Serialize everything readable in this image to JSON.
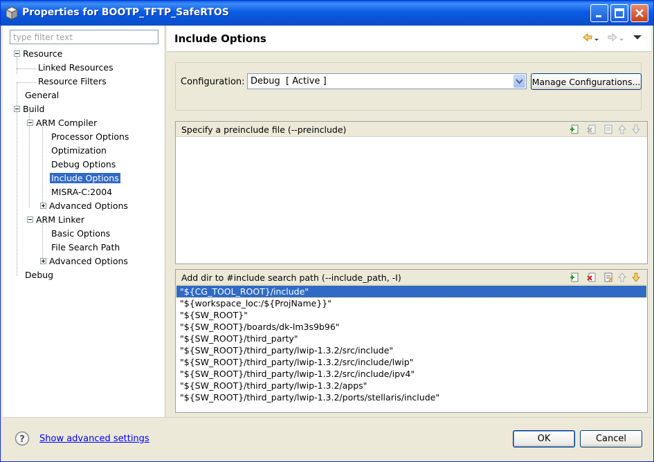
{
  "window": {
    "title": "Properties for BOOTP_TFTP_SafeRTOS"
  },
  "filter": {
    "placeholder": "type filter text"
  },
  "tree": [
    {
      "label": "Resource",
      "expander": "minus"
    },
    {
      "label": "Linked Resources"
    },
    {
      "label": "Resource Filters"
    },
    {
      "label": "General"
    },
    {
      "label": "Build",
      "expander": "minus"
    },
    {
      "label": "ARM Compiler",
      "expander": "minus"
    },
    {
      "label": "Processor Options"
    },
    {
      "label": "Optimization"
    },
    {
      "label": "Debug Options"
    },
    {
      "label": "Include Options",
      "selected": true
    },
    {
      "label": "MISRA-C:2004"
    },
    {
      "label": "Advanced Options",
      "expander": "plus"
    },
    {
      "label": "ARM Linker",
      "expander": "minus"
    },
    {
      "label": "Basic Options"
    },
    {
      "label": "File Search Path"
    },
    {
      "label": "Advanced Options",
      "expander": "plus"
    },
    {
      "label": "Debug"
    }
  ],
  "page": {
    "title": "Include Options"
  },
  "config": {
    "label": "Configuration:",
    "value": "Debug  [ Active ]",
    "manage_label": "Manage Configurations..."
  },
  "preinclude": {
    "title": "Specify a preinclude file (--preinclude)",
    "items": []
  },
  "include_path": {
    "title": "Add dir to #include search path (--include_path, -I)",
    "items": [
      "\"${CG_TOOL_ROOT}/include\"",
      "\"${workspace_loc:/${ProjName}}\"",
      "\"${SW_ROOT}\"",
      "\"${SW_ROOT}/boards/dk-lm3s9b96\"",
      "\"${SW_ROOT}/third_party\"",
      "\"${SW_ROOT}/third_party/lwip-1.3.2/src/include\"",
      "\"${SW_ROOT}/third_party/lwip-1.3.2/src/include/lwip\"",
      "\"${SW_ROOT}/third_party/lwip-1.3.2/src/include/ipv4\"",
      "\"${SW_ROOT}/third_party/lwip-1.3.2/apps\"",
      "\"${SW_ROOT}/third_party/lwip-1.3.2/ports/stellaris/include\""
    ],
    "selected_index": 0
  },
  "footer": {
    "advanced_link": "Show advanced settings",
    "ok_label": "OK",
    "cancel_label": "Cancel"
  },
  "colors": {
    "selection": "#316ac5",
    "titlebar": "#0a54d8",
    "dialog_bg": "#ece9d8"
  }
}
